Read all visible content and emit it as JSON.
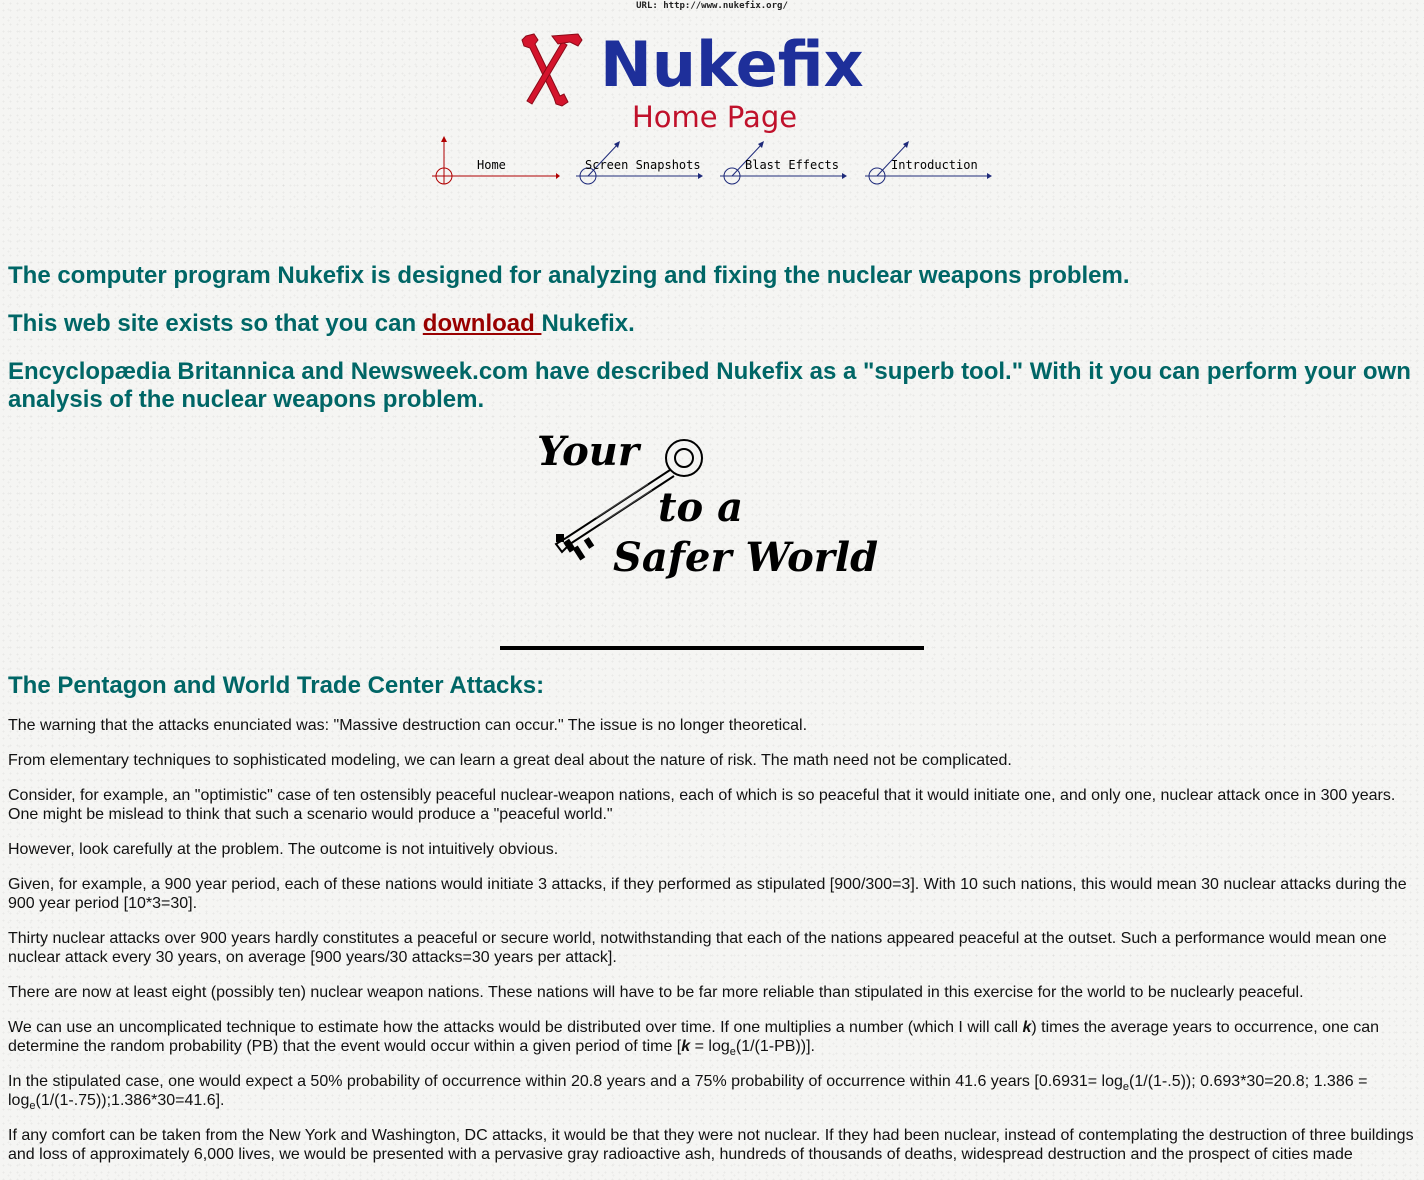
{
  "url_line": "URL: http://www.nukefix.org/",
  "logo": {
    "title": "Nukefix",
    "subtitle": "Home Page",
    "icon": "hammer-wrench-icon",
    "title_color": "#1e2f9a",
    "subtitle_color": "#c0112b"
  },
  "nav": {
    "items": [
      {
        "label": "Home",
        "active": true
      },
      {
        "label": "Screen Snapshots",
        "active": false
      },
      {
        "label": "Blast Effects",
        "active": false
      },
      {
        "label": "Introduction",
        "active": false
      }
    ]
  },
  "intro": {
    "line1": "The computer program Nukefix is designed for analyzing and fixing the nuclear weapons problem.",
    "line2_pre": "This web site exists so that you can ",
    "line2_link": "download ",
    "line2_post": "Nukefix.",
    "line3": "Encyclopædia Britannica and Newsweek.com have described Nukefix as a \"superb tool.\" With it you can perform your own analysis of the nuclear weapons problem."
  },
  "banner": {
    "word1": "Your",
    "word2": "to a",
    "word3": "Safer World",
    "icon": "key-icon"
  },
  "section": {
    "heading": "The Pentagon and World Trade Center Attacks:",
    "p1": "The warning that the attacks enunciated was: \"Massive destruction can occur.\" The issue is no longer theoretical.",
    "p2": "From elementary techniques to sophisticated modeling, we can learn a great deal about the nature of risk. The math need not be complicated.",
    "p3": "Consider, for example, an \"optimistic\" case of ten ostensibly peaceful nuclear-weapon nations, each of which is so peaceful that it would initiate one, and only one, nuclear attack once in 300 years. One might be mislead to think that such a scenario would produce a \"peaceful world.\"",
    "p4": "However, look carefully at the problem. The outcome is not intuitively obvious.",
    "p5": "Given, for example, a 900 year period, each of these nations would initiate 3 attacks, if they performed as stipulated [900/300=3]. With 10 such nations, this would mean 30 nuclear attacks during the 900 year period [10*3=30].",
    "p6": "Thirty nuclear attacks over 900 years hardly constitutes a peaceful or secure world, notwithstanding that each of the nations appeared peaceful at the outset. Such a performance would mean one nuclear attack every 30 years, on average [900 years/30 attacks=30 years per attack].",
    "p7": "There are now at least eight (possibly ten) nuclear weapon nations. These nations will have to be far more reliable than stipulated in this exercise for the world to be nuclearly peaceful.",
    "p8_a": "We can use an uncomplicated technique to estimate how the attacks would be distributed over time. If one multiplies a number (which I will call ",
    "p8_k": "k",
    "p8_b": ") times the average years to occurrence, one can determine the random probability (PB) that the event would occur within a given period of time [",
    "p8_k2": "k",
    "p8_c": " = log",
    "p8_sub": "e",
    "p8_d": "(1/(1-PB))].",
    "p9_a": "In the stipulated case, one would expect a 50% probability of occurrence within 20.8 years and a 75% probability of occurrence within 41.6 years [0.6931= log",
    "p9_sub1": "e",
    "p9_b": "(1/(1-.5)); 0.693*30=20.8; 1.386 = log",
    "p9_sub2": "e",
    "p9_c": "(1/(1-.75));1.386*30=41.6].",
    "p10": "If any comfort can be taken from the New York and Washington, DC attacks, it would be that they were not nuclear. If they had been nuclear, instead of contemplating the destruction of three buildings and loss of approximately 6,000 lives, we would be presented with a pervasive gray radioactive ash, hundreds of thousands of deaths, widespread destruction and the prospect of cities made"
  }
}
